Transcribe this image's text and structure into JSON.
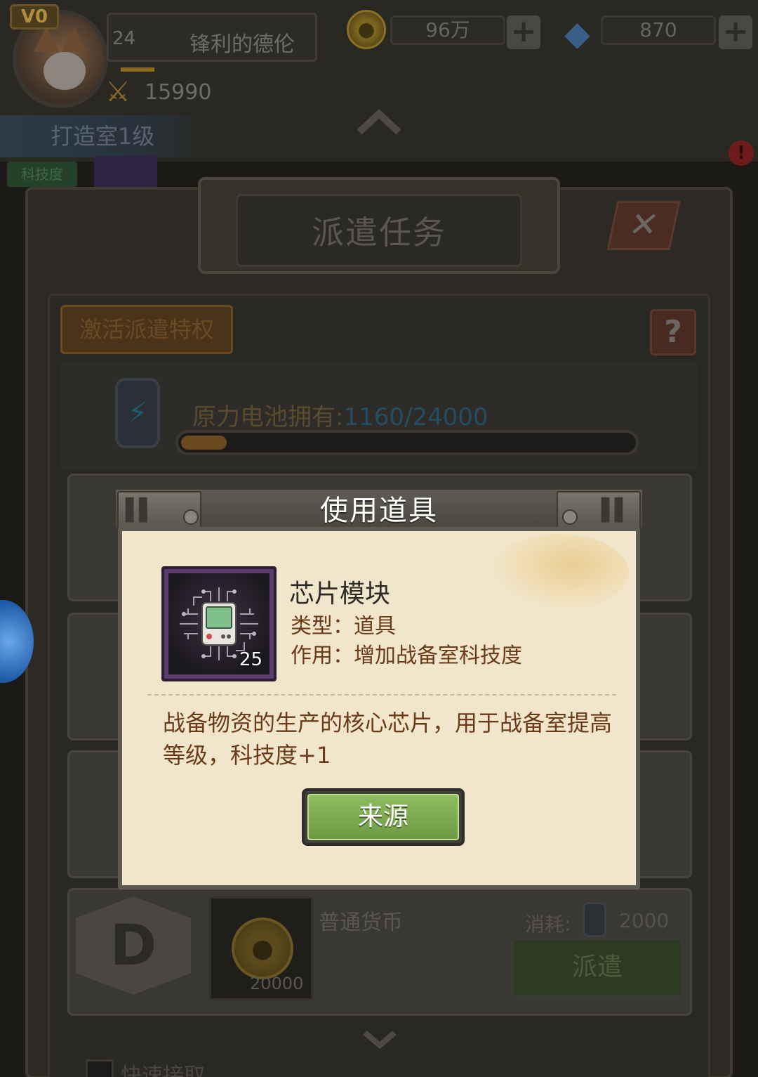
{
  "header": {
    "vip": "V0",
    "level": "24",
    "player_name": "锋利的德伦",
    "power": "15990",
    "coins": "96万",
    "gems": "870",
    "room": "打造室1级",
    "tech_tag": "科技度"
  },
  "panel": {
    "title": "派遣任务",
    "privilege_button": "激活派遣特权",
    "battery_label": "原力电池拥有:",
    "battery_value": "1160/24000",
    "battery_fraction": 0.048,
    "quick_label": "快速接取"
  },
  "mission": {
    "rank": "D",
    "reward_name": "普通货币",
    "reward_count": "20000",
    "cost_label": "消耗:",
    "cost_value": "2000",
    "dispatch_label": "派遣"
  },
  "modal": {
    "title": "使用道具",
    "item_name": "芯片模块",
    "item_type": "类型：道具",
    "item_effect": "作用：增加战备室科技度",
    "item_count": "25",
    "description": "战备物资的生产的核心芯片，用于战备室提高等级，科技度+1",
    "source_button": "来源"
  },
  "colors": {
    "modal_bg": "#f1e6cc",
    "source_button": "#7aa84f",
    "text_brown": "#6b3a18"
  }
}
